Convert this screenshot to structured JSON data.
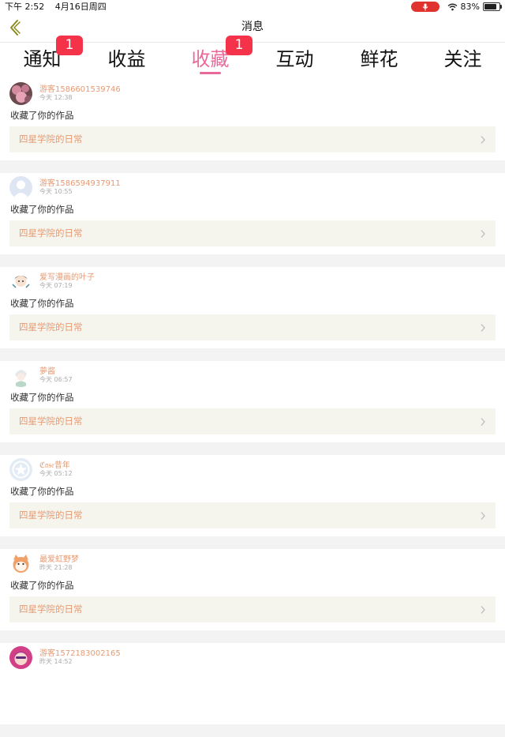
{
  "status_bar": {
    "time": "下午 2:52",
    "date": "4月16日周四",
    "battery": "83%",
    "battery_level": 0.83
  },
  "nav": {
    "title": "消息"
  },
  "tabs": [
    {
      "label": "通知",
      "badge": "1"
    },
    {
      "label": "收益",
      "badge": ""
    },
    {
      "label": "收藏",
      "badge": "1",
      "active": true
    },
    {
      "label": "互动",
      "badge": ""
    },
    {
      "label": "鲜花",
      "badge": ""
    },
    {
      "label": "关注",
      "badge": ""
    }
  ],
  "items": [
    {
      "user": "游客1586601539746",
      "time": "今天 12:38",
      "action": "收藏了你的作品",
      "work": "四星学院的日常",
      "avatar": "avatar-flowers"
    },
    {
      "user": "游客1586594937911",
      "time": "今天 10:55",
      "action": "收藏了你的作品",
      "work": "四星学院的日常",
      "avatar": "avatar-default"
    },
    {
      "user": "爱写漫画的叶子",
      "time": "今天 07:19",
      "action": "收藏了你的作品",
      "work": "四星学院的日常",
      "avatar": "avatar-anime-girl"
    },
    {
      "user": "夢酱",
      "time": "今天 06:57",
      "action": "收藏了你的作品",
      "work": "四星学院的日常",
      "avatar": "avatar-white-hair"
    },
    {
      "user": "ℭ𝔞𝔰𝔢昔年",
      "time": "今天 05:12",
      "action": "收藏了你的作品",
      "work": "四星学院的日常",
      "avatar": "avatar-star"
    },
    {
      "user": "最爱虹野梦",
      "time": "昨天 21:28",
      "action": "收藏了你的作品",
      "work": "四星学院的日常",
      "avatar": "avatar-cartoon-cat"
    },
    {
      "user": "游客1572183002165",
      "time": "昨天 14:52",
      "action": "",
      "work": "",
      "avatar": "avatar-pink-hair"
    }
  ],
  "colors": {
    "accent": "#e8699a",
    "badge": "#f4334a",
    "username": "#e79a72",
    "work_box": "#f5f5ee"
  }
}
